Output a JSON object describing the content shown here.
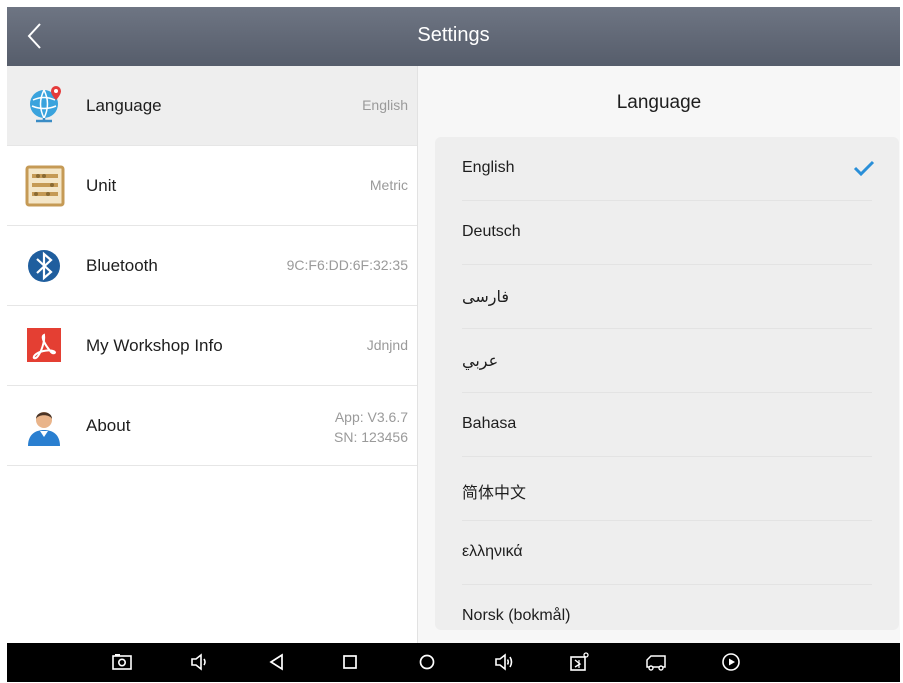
{
  "titlebar": {
    "title": "Settings"
  },
  "settings": {
    "items": [
      {
        "label": "Language",
        "value": "English"
      },
      {
        "label": "Unit",
        "value": "Metric"
      },
      {
        "label": "Bluetooth",
        "value": "9C:F6:DD:6F:32:35"
      },
      {
        "label": "My Workshop Info",
        "value": "Jdnjnd"
      },
      {
        "label": "About",
        "value_line1": "App: V3.6.7",
        "value_line2": "SN: 123456"
      }
    ],
    "selected": "Language"
  },
  "language_panel": {
    "heading": "Language",
    "selected": "English",
    "options": [
      "English",
      "Deutsch",
      "فارسی",
      "عربي",
      "Bahasa",
      "简体中文",
      "ελληνικά",
      "Norsk (bokmål)"
    ]
  },
  "colors": {
    "titlebar": "#60677a",
    "check": "#2a8fd8",
    "selected_row": "#eeeeee"
  },
  "navbar": {
    "icons": [
      "screenshot-icon",
      "volume-down-icon",
      "back-icon",
      "home-icon",
      "recents-icon",
      "volume-up-icon",
      "vci-icon",
      "truck-icon",
      "play-icon"
    ]
  }
}
